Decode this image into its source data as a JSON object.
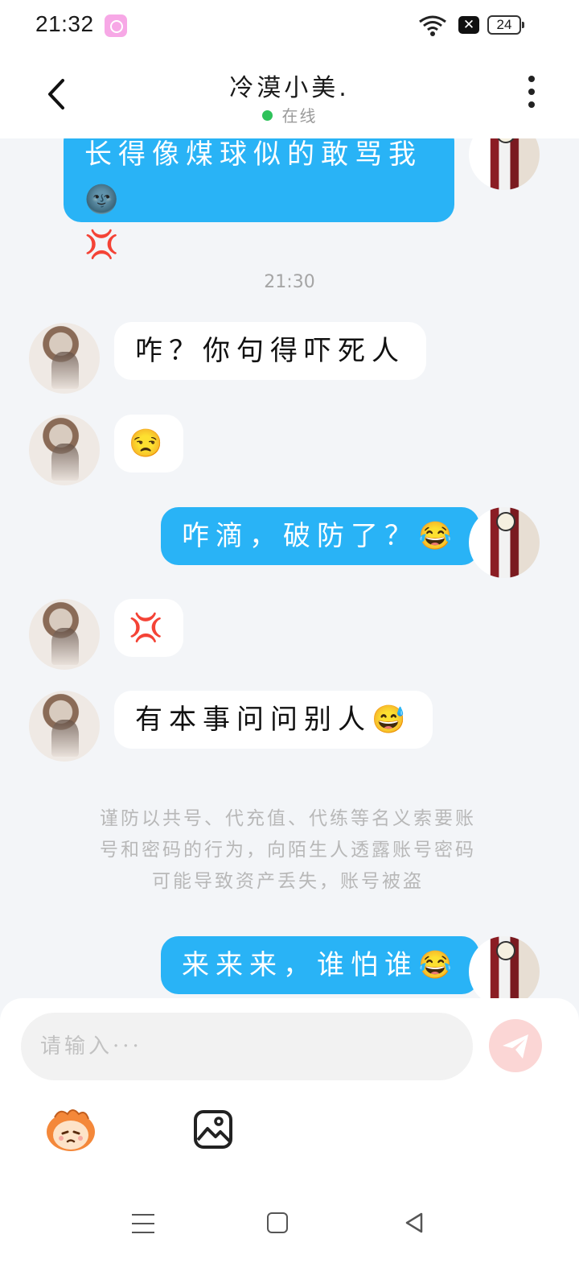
{
  "status_bar": {
    "time": "21:32",
    "battery": "24",
    "icons": [
      "camera-app-icon",
      "wifi-icon",
      "x-notification-icon",
      "battery-icon"
    ]
  },
  "header": {
    "title": "冷漠小美.",
    "status": "在线",
    "status_color": "#2ec25a",
    "back_icon": "chevron-left-icon",
    "more_icon": "more-vertical-icon"
  },
  "chat": {
    "messages": [
      {
        "from": "me",
        "text": "长得像煤球似的敢骂我🌚",
        "text2": "💢"
      },
      {
        "type": "timestamp",
        "text": "21:30"
      },
      {
        "from": "other",
        "text": "咋？你句得吓死人"
      },
      {
        "from": "other",
        "text": "😒"
      },
      {
        "from": "me",
        "text": "咋滴，破防了？😂"
      },
      {
        "from": "other",
        "text": "💢"
      },
      {
        "from": "other",
        "text": "有本事问问别人😅"
      },
      {
        "type": "notice",
        "lines": [
          "谨防以共号、代充值、代练等名义索要账",
          "号和密码的行为，向陌生人透露账号密码",
          "可能导致资产丢失，账号被盗"
        ]
      },
      {
        "from": "me",
        "text": "来来来，谁怕谁😂"
      }
    ],
    "colors": {
      "my_bubble": "#29b3f6",
      "other_bubble": "#ffffff",
      "background": "#f3f5f8"
    }
  },
  "input": {
    "placeholder": "请输入···",
    "value": "",
    "send_icon": "send-icon",
    "emoji_icon": "emoji-face-icon",
    "image_icon": "image-icon"
  },
  "nav": {
    "icons": [
      "menu-icon",
      "home-icon",
      "back-triangle-icon"
    ]
  }
}
